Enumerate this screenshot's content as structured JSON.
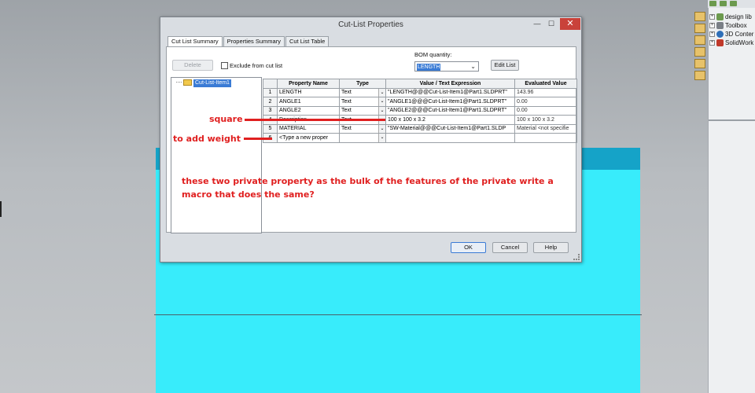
{
  "dialog": {
    "title": "Cut-List Properties",
    "tabs": [
      {
        "label": "Cut List Summary",
        "active": true
      },
      {
        "label": "Properties Summary",
        "active": false
      },
      {
        "label": "Cut List Table",
        "active": false
      }
    ],
    "delete_label": "Delete",
    "exclude_label": "Exclude from cut list",
    "bom_label": "BOM quantity:",
    "bom_value": "LENGTH",
    "edit_list_label": "Edit List",
    "tree_item": "Cut-List-Item1",
    "ok_label": "OK",
    "cancel_label": "Cancel",
    "help_label": "Help"
  },
  "grid": {
    "headers": [
      "",
      "Property Name",
      "Type",
      "Value / Text Expression",
      "Evaluated Value"
    ],
    "rows": [
      {
        "n": "1",
        "name": "LENGTH",
        "type": "Text",
        "expr": "\"LENGTH@@@Cut-List-Item1@Part1.SLDPRT\"",
        "eval": "143.96"
      },
      {
        "n": "2",
        "name": "ANGLE1",
        "type": "Text",
        "expr": "\"ANGLE1@@@Cut-List-Item1@Part1.SLDPRT\"",
        "eval": "0.00"
      },
      {
        "n": "3",
        "name": "ANGLE2",
        "type": "Text",
        "expr": "\"ANGLE2@@@Cut-List-Item1@Part1.SLDPRT\"",
        "eval": "0.00"
      },
      {
        "n": "4",
        "name": "Description",
        "type": "Text",
        "expr": "100 x 100 x 3.2",
        "eval": "100 x 100 x 3.2"
      },
      {
        "n": "5",
        "name": "MATERIAL",
        "type": "Text",
        "expr": "\"SW-Material@@@Cut-List-Item1@Part1.SLDP",
        "eval": "Material <not specifie"
      },
      {
        "n": "6",
        "name": "<Type a new proper",
        "type": "",
        "expr": "",
        "eval": ""
      }
    ]
  },
  "annotations": {
    "square": "square",
    "add_weight": "to add weight",
    "note": "these two private property as the bulk of the features of the private write a macro that does the same?"
  },
  "right_panel": {
    "items": [
      "design lib",
      "Toolbox",
      "3D Conter",
      "SolidWork"
    ]
  },
  "colors": {
    "annotation": "#e02020",
    "part_face": "#38ecfb",
    "selection": "#3a7bd5"
  }
}
